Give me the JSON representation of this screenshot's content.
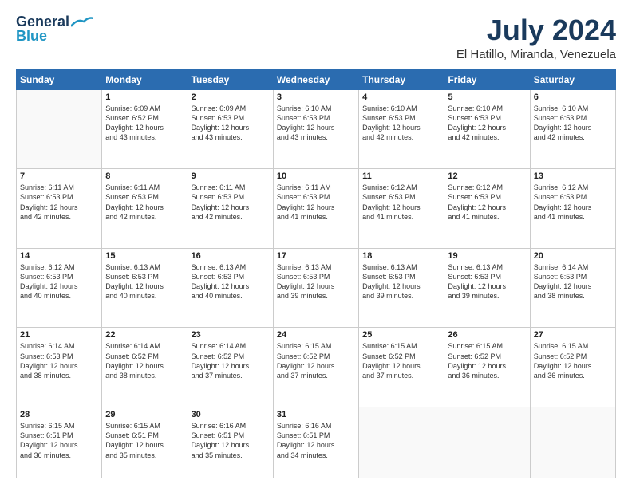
{
  "header": {
    "logo_line1": "General",
    "logo_line2": "Blue",
    "title": "July 2024",
    "subtitle": "El Hatillo, Miranda, Venezuela"
  },
  "days_of_week": [
    "Sunday",
    "Monday",
    "Tuesday",
    "Wednesday",
    "Thursday",
    "Friday",
    "Saturday"
  ],
  "weeks": [
    [
      {
        "day": "",
        "info": ""
      },
      {
        "day": "1",
        "info": "Sunrise: 6:09 AM\nSunset: 6:52 PM\nDaylight: 12 hours\nand 43 minutes."
      },
      {
        "day": "2",
        "info": "Sunrise: 6:09 AM\nSunset: 6:53 PM\nDaylight: 12 hours\nand 43 minutes."
      },
      {
        "day": "3",
        "info": "Sunrise: 6:10 AM\nSunset: 6:53 PM\nDaylight: 12 hours\nand 43 minutes."
      },
      {
        "day": "4",
        "info": "Sunrise: 6:10 AM\nSunset: 6:53 PM\nDaylight: 12 hours\nand 42 minutes."
      },
      {
        "day": "5",
        "info": "Sunrise: 6:10 AM\nSunset: 6:53 PM\nDaylight: 12 hours\nand 42 minutes."
      },
      {
        "day": "6",
        "info": "Sunrise: 6:10 AM\nSunset: 6:53 PM\nDaylight: 12 hours\nand 42 minutes."
      }
    ],
    [
      {
        "day": "7",
        "info": "Sunrise: 6:11 AM\nSunset: 6:53 PM\nDaylight: 12 hours\nand 42 minutes."
      },
      {
        "day": "8",
        "info": "Sunrise: 6:11 AM\nSunset: 6:53 PM\nDaylight: 12 hours\nand 42 minutes."
      },
      {
        "day": "9",
        "info": "Sunrise: 6:11 AM\nSunset: 6:53 PM\nDaylight: 12 hours\nand 42 minutes."
      },
      {
        "day": "10",
        "info": "Sunrise: 6:11 AM\nSunset: 6:53 PM\nDaylight: 12 hours\nand 41 minutes."
      },
      {
        "day": "11",
        "info": "Sunrise: 6:12 AM\nSunset: 6:53 PM\nDaylight: 12 hours\nand 41 minutes."
      },
      {
        "day": "12",
        "info": "Sunrise: 6:12 AM\nSunset: 6:53 PM\nDaylight: 12 hours\nand 41 minutes."
      },
      {
        "day": "13",
        "info": "Sunrise: 6:12 AM\nSunset: 6:53 PM\nDaylight: 12 hours\nand 41 minutes."
      }
    ],
    [
      {
        "day": "14",
        "info": "Sunrise: 6:12 AM\nSunset: 6:53 PM\nDaylight: 12 hours\nand 40 minutes."
      },
      {
        "day": "15",
        "info": "Sunrise: 6:13 AM\nSunset: 6:53 PM\nDaylight: 12 hours\nand 40 minutes."
      },
      {
        "day": "16",
        "info": "Sunrise: 6:13 AM\nSunset: 6:53 PM\nDaylight: 12 hours\nand 40 minutes."
      },
      {
        "day": "17",
        "info": "Sunrise: 6:13 AM\nSunset: 6:53 PM\nDaylight: 12 hours\nand 39 minutes."
      },
      {
        "day": "18",
        "info": "Sunrise: 6:13 AM\nSunset: 6:53 PM\nDaylight: 12 hours\nand 39 minutes."
      },
      {
        "day": "19",
        "info": "Sunrise: 6:13 AM\nSunset: 6:53 PM\nDaylight: 12 hours\nand 39 minutes."
      },
      {
        "day": "20",
        "info": "Sunrise: 6:14 AM\nSunset: 6:53 PM\nDaylight: 12 hours\nand 38 minutes."
      }
    ],
    [
      {
        "day": "21",
        "info": "Sunrise: 6:14 AM\nSunset: 6:53 PM\nDaylight: 12 hours\nand 38 minutes."
      },
      {
        "day": "22",
        "info": "Sunrise: 6:14 AM\nSunset: 6:52 PM\nDaylight: 12 hours\nand 38 minutes."
      },
      {
        "day": "23",
        "info": "Sunrise: 6:14 AM\nSunset: 6:52 PM\nDaylight: 12 hours\nand 37 minutes."
      },
      {
        "day": "24",
        "info": "Sunrise: 6:15 AM\nSunset: 6:52 PM\nDaylight: 12 hours\nand 37 minutes."
      },
      {
        "day": "25",
        "info": "Sunrise: 6:15 AM\nSunset: 6:52 PM\nDaylight: 12 hours\nand 37 minutes."
      },
      {
        "day": "26",
        "info": "Sunrise: 6:15 AM\nSunset: 6:52 PM\nDaylight: 12 hours\nand 36 minutes."
      },
      {
        "day": "27",
        "info": "Sunrise: 6:15 AM\nSunset: 6:52 PM\nDaylight: 12 hours\nand 36 minutes."
      }
    ],
    [
      {
        "day": "28",
        "info": "Sunrise: 6:15 AM\nSunset: 6:51 PM\nDaylight: 12 hours\nand 36 minutes."
      },
      {
        "day": "29",
        "info": "Sunrise: 6:15 AM\nSunset: 6:51 PM\nDaylight: 12 hours\nand 35 minutes."
      },
      {
        "day": "30",
        "info": "Sunrise: 6:16 AM\nSunset: 6:51 PM\nDaylight: 12 hours\nand 35 minutes."
      },
      {
        "day": "31",
        "info": "Sunrise: 6:16 AM\nSunset: 6:51 PM\nDaylight: 12 hours\nand 34 minutes."
      },
      {
        "day": "",
        "info": ""
      },
      {
        "day": "",
        "info": ""
      },
      {
        "day": "",
        "info": ""
      }
    ]
  ]
}
